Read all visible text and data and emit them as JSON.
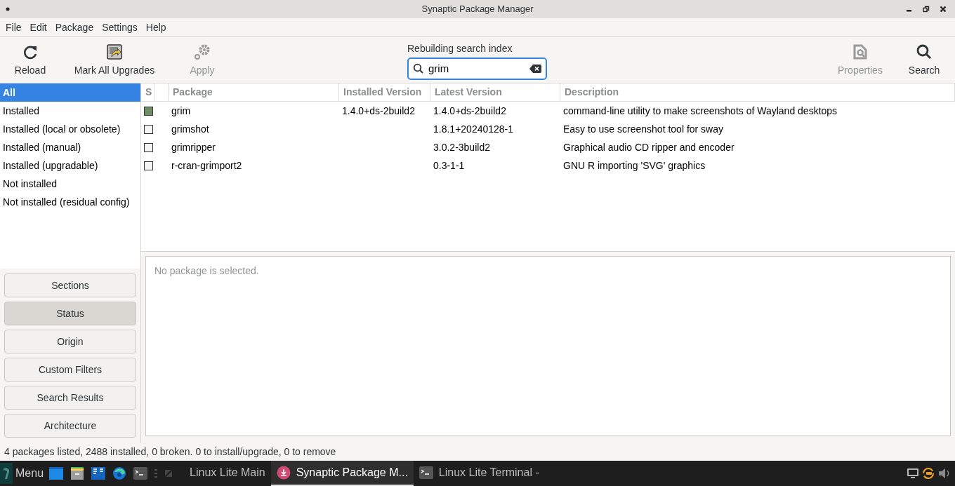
{
  "window": {
    "title": "Synaptic Package Manager"
  },
  "menu": [
    "File",
    "Edit",
    "Package",
    "Settings",
    "Help"
  ],
  "toolbar": [
    {
      "kind": "reload",
      "label": "Reload",
      "disabled": false
    },
    {
      "kind": "upgrade",
      "label": "Mark All Upgrades",
      "disabled": false
    },
    {
      "kind": "apply",
      "label": "Apply",
      "disabled": true
    }
  ],
  "search": {
    "label": "Rebuilding search index",
    "value": "grim"
  },
  "toolbar_right": [
    {
      "kind": "properties",
      "label": "Properties",
      "disabled": true
    },
    {
      "kind": "search",
      "label": "Search",
      "disabled": false
    }
  ],
  "filters": [
    {
      "label": "All",
      "selected": true
    },
    {
      "label": "Installed",
      "selected": false
    },
    {
      "label": "Installed (local or obsolete)",
      "selected": false
    },
    {
      "label": "Installed (manual)",
      "selected": false
    },
    {
      "label": "Installed (upgradable)",
      "selected": false
    },
    {
      "label": "Not installed",
      "selected": false
    },
    {
      "label": "Not installed (residual config)",
      "selected": false
    }
  ],
  "filter_buttons": [
    {
      "label": "Sections",
      "selected": false
    },
    {
      "label": "Status",
      "selected": true
    },
    {
      "label": "Origin",
      "selected": false
    },
    {
      "label": "Custom Filters",
      "selected": false
    },
    {
      "label": "Search Results",
      "selected": false
    },
    {
      "label": "Architecture",
      "selected": false
    }
  ],
  "table": {
    "columns": [
      "S",
      "Package",
      "Installed Version",
      "Latest Version",
      "Description"
    ],
    "rows": [
      {
        "installed": true,
        "package": "grim",
        "installed_version": "1.4.0+ds-2build2",
        "latest_version": "1.4.0+ds-2build2",
        "description": "command-line utility to make screenshots of Wayland desktops"
      },
      {
        "installed": false,
        "package": "grimshot",
        "latest_version": "1.8.1+20240128-1",
        "description": "Easy to use screenshot tool for sway"
      },
      {
        "installed": false,
        "package": "grimripper",
        "latest_version": "3.0.2-3build2",
        "description": "Graphical audio CD ripper and encoder"
      },
      {
        "installed": false,
        "package": "r-cran-grimport2",
        "latest_version": "0.3-1-1",
        "description": "GNU R importing 'SVG' graphics"
      }
    ]
  },
  "details": {
    "text": "No package is selected."
  },
  "status_bar": "4 packages listed, 2488 installed, 0 broken. 0 to install/upgrade, 0 to remove",
  "taskbar": {
    "menu_label": "Menu",
    "windows": [
      {
        "kind": "folder",
        "label": "Linux Lite Main",
        "selected": false
      },
      {
        "kind": "synaptic",
        "label": "Synaptic Package M...",
        "selected": true
      },
      {
        "kind": "terminal",
        "label": "Linux Lite Terminal -",
        "selected": false
      }
    ]
  }
}
